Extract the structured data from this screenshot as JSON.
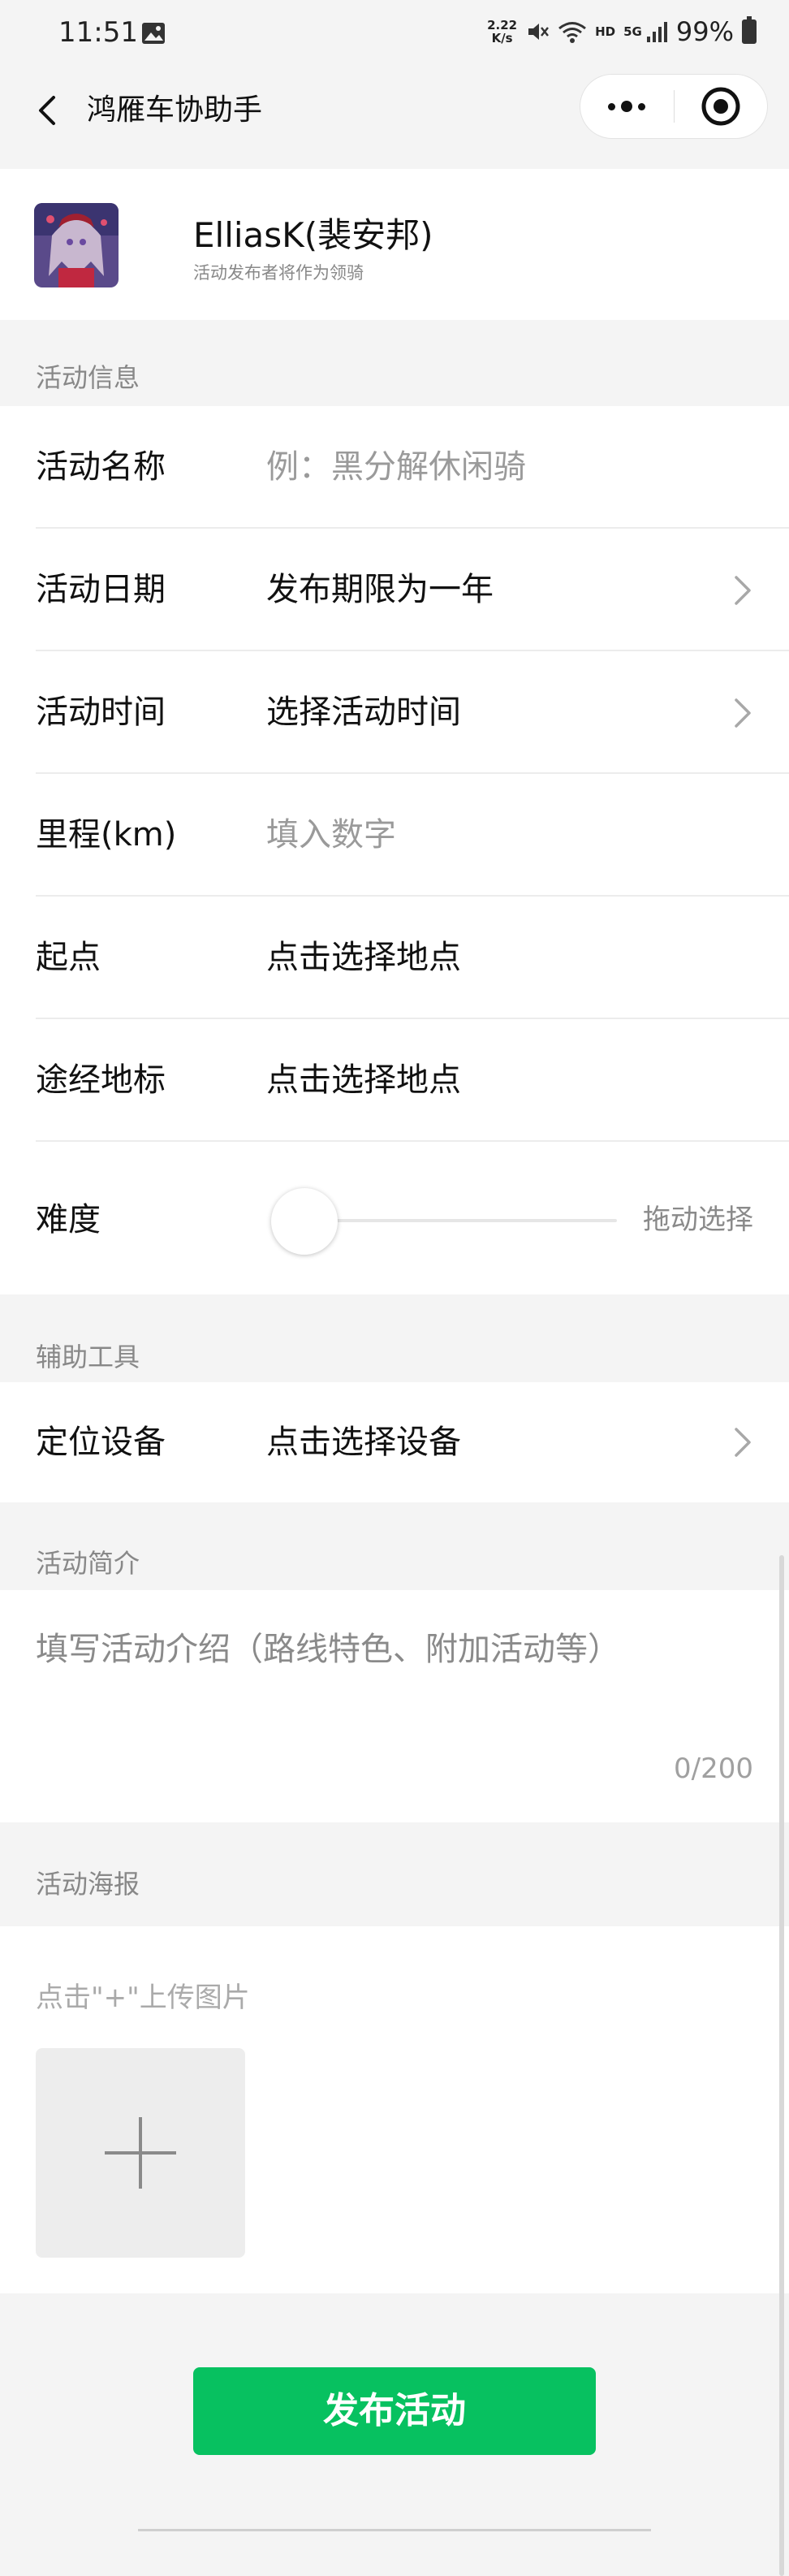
{
  "status_bar": {
    "time": "11:51",
    "speed_value": "2.22",
    "speed_unit": "K/s",
    "hd": "HD",
    "net": "5G",
    "battery": "99%"
  },
  "nav": {
    "title": "鸿雁车协助手"
  },
  "publisher": {
    "name": "ElliasK(裴安邦)",
    "hint": "活动发布者将作为领骑"
  },
  "sections": {
    "info": "活动信息",
    "tools": "辅助工具",
    "intro": "活动简介",
    "poster": "活动海报"
  },
  "form": {
    "name": {
      "label": "活动名称",
      "placeholder": "例：黑分解休闲骑"
    },
    "date": {
      "label": "活动日期",
      "value": "发布期限为一年"
    },
    "time": {
      "label": "活动时间",
      "value": "选择活动时间"
    },
    "mileage": {
      "label": "里程(km)",
      "placeholder": "填入数字"
    },
    "start": {
      "label": "起点",
      "value": "点击选择地点"
    },
    "waypoints": {
      "label": "途经地标",
      "value": "点击选择地点"
    },
    "difficulty": {
      "label": "难度",
      "hint": "拖动选择",
      "level": 0
    },
    "device": {
      "label": "定位设备",
      "value": "点击选择设备"
    }
  },
  "intro": {
    "placeholder": "填写活动介绍（路线特色、附加活动等）",
    "counter": "0/200"
  },
  "poster": {
    "hint": "点击\"+\"上传图片"
  },
  "publish_label": "发布活动",
  "colors": {
    "accent": "#07c160",
    "page_bg": "#f4f4f4",
    "card_bg": "#ffffff"
  },
  "icons": {
    "back": "chevron-left-icon",
    "more": "more-dots-icon",
    "close": "target-close-icon",
    "chevron": "chevron-right-icon",
    "upload": "plus-icon"
  }
}
